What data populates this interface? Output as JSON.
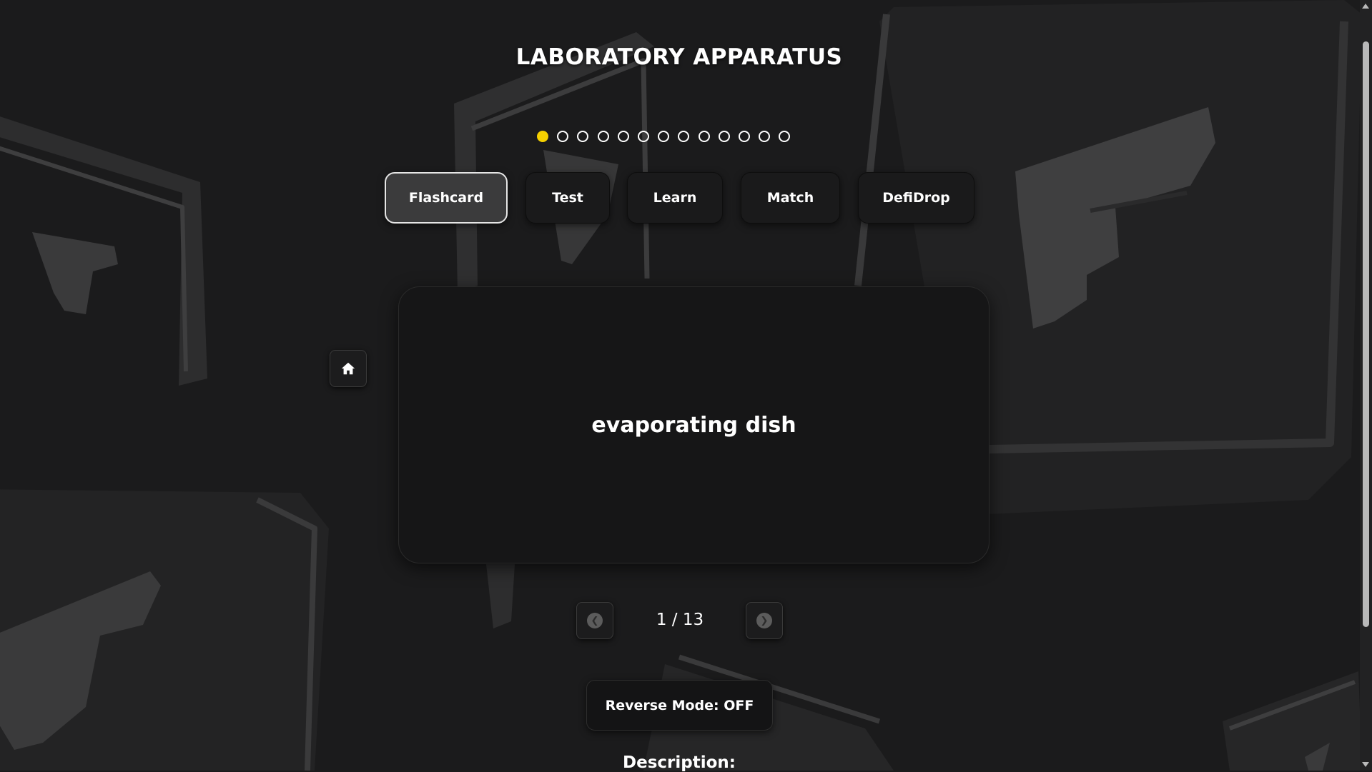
{
  "page": {
    "title": "LABORATORY APPARATUS"
  },
  "progress": {
    "total": 13,
    "current_index": 1,
    "active_color": "#f5d000"
  },
  "modes": {
    "items": [
      {
        "label": "Flashcard",
        "active": true
      },
      {
        "label": "Test",
        "active": false
      },
      {
        "label": "Learn",
        "active": false
      },
      {
        "label": "Match",
        "active": false
      },
      {
        "label": "DefiDrop",
        "active": false
      }
    ]
  },
  "home": {
    "icon": "home-icon"
  },
  "card": {
    "term": "evaporating dish"
  },
  "navigation": {
    "counter": "1 / 13",
    "prev_icon": "chevron-left-icon",
    "next_icon": "chevron-right-icon"
  },
  "reverse": {
    "label": "Reverse Mode: OFF"
  },
  "description": {
    "heading": "Description:"
  }
}
